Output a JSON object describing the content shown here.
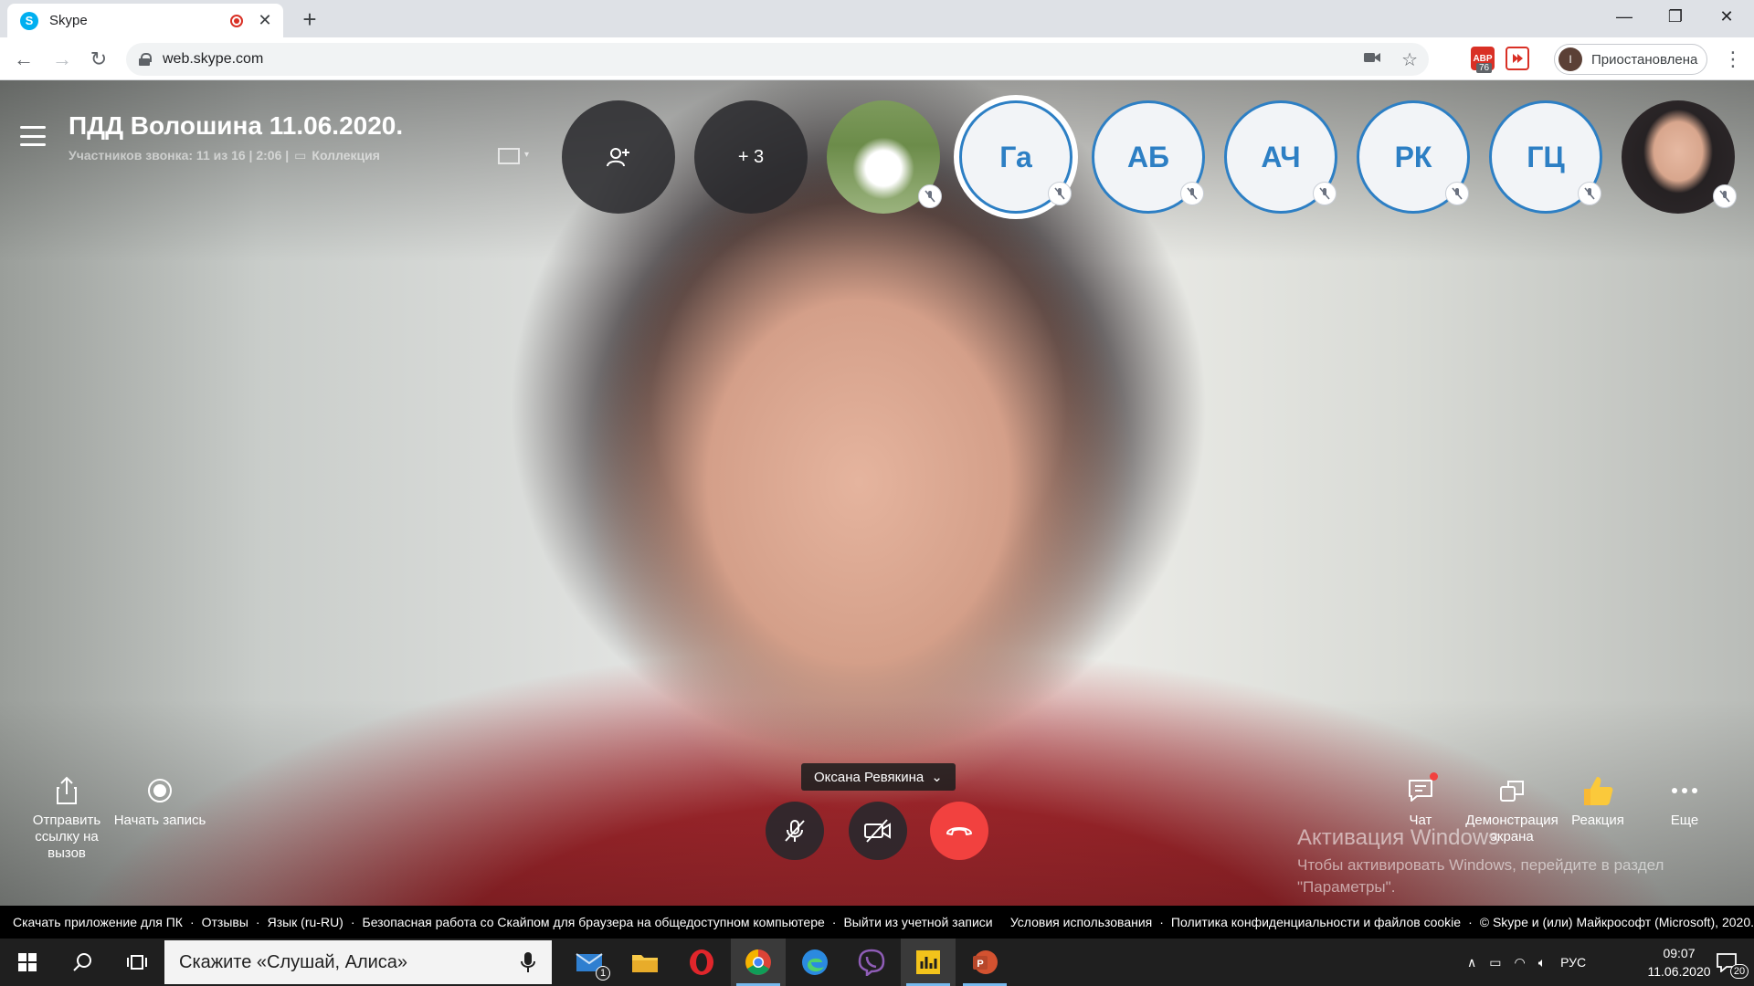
{
  "browser": {
    "tab_title": "Skype",
    "favicon_letter": "S",
    "url": "web.skype.com",
    "profile_label": "Приостановлена",
    "profile_initial": "I",
    "ext_badge_count": "76",
    "ext_badge_text": "ABP"
  },
  "call": {
    "title": "ПДД Волошина 11.06.2020.",
    "subtitle": "Участников звонка: 11 из 16 | 2:06 |",
    "collection_label": "Коллекция",
    "more_participants": "+ 3",
    "participants": [
      {
        "initials": "Га"
      },
      {
        "initials": "АБ"
      },
      {
        "initials": "АЧ"
      },
      {
        "initials": "РК"
      },
      {
        "initials": "ГЦ"
      }
    ],
    "caller_name": "Оксана Ревякина"
  },
  "actions": {
    "share_link": "Отправить ссылку на вызов",
    "start_recording": "Начать запись",
    "chat": "Чат",
    "screen_share": "Демонстрация экрана",
    "reaction": "Реакция",
    "more": "Еще"
  },
  "activation": {
    "title": "Активация Windows",
    "text": "Чтобы активировать Windows, перейдите в раздел \"Параметры\"."
  },
  "footer": {
    "links": [
      "Скачать приложение для ПК",
      "Отзывы",
      "Язык (ru-RU)",
      "Безопасная работа со Скайпом для браузера на общедоступном компьютере",
      "Выйти из учетной записи"
    ],
    "right_links": [
      "Условия использования",
      "Политика конфиденциальности и файлов cookie",
      "© Skype и (или) Майкрософт (Microsoft), 2020."
    ]
  },
  "taskbar": {
    "search_placeholder": "Скажите «Слушай, Алиса»",
    "mail_badge": "1",
    "language": "РУС",
    "time": "09:07",
    "date": "11.06.2020",
    "notifications_count": "20"
  },
  "colors": {
    "skype_blue": "#00aff0",
    "initials_blue": "#2d7fc4",
    "hangup_red": "#f2413f"
  }
}
